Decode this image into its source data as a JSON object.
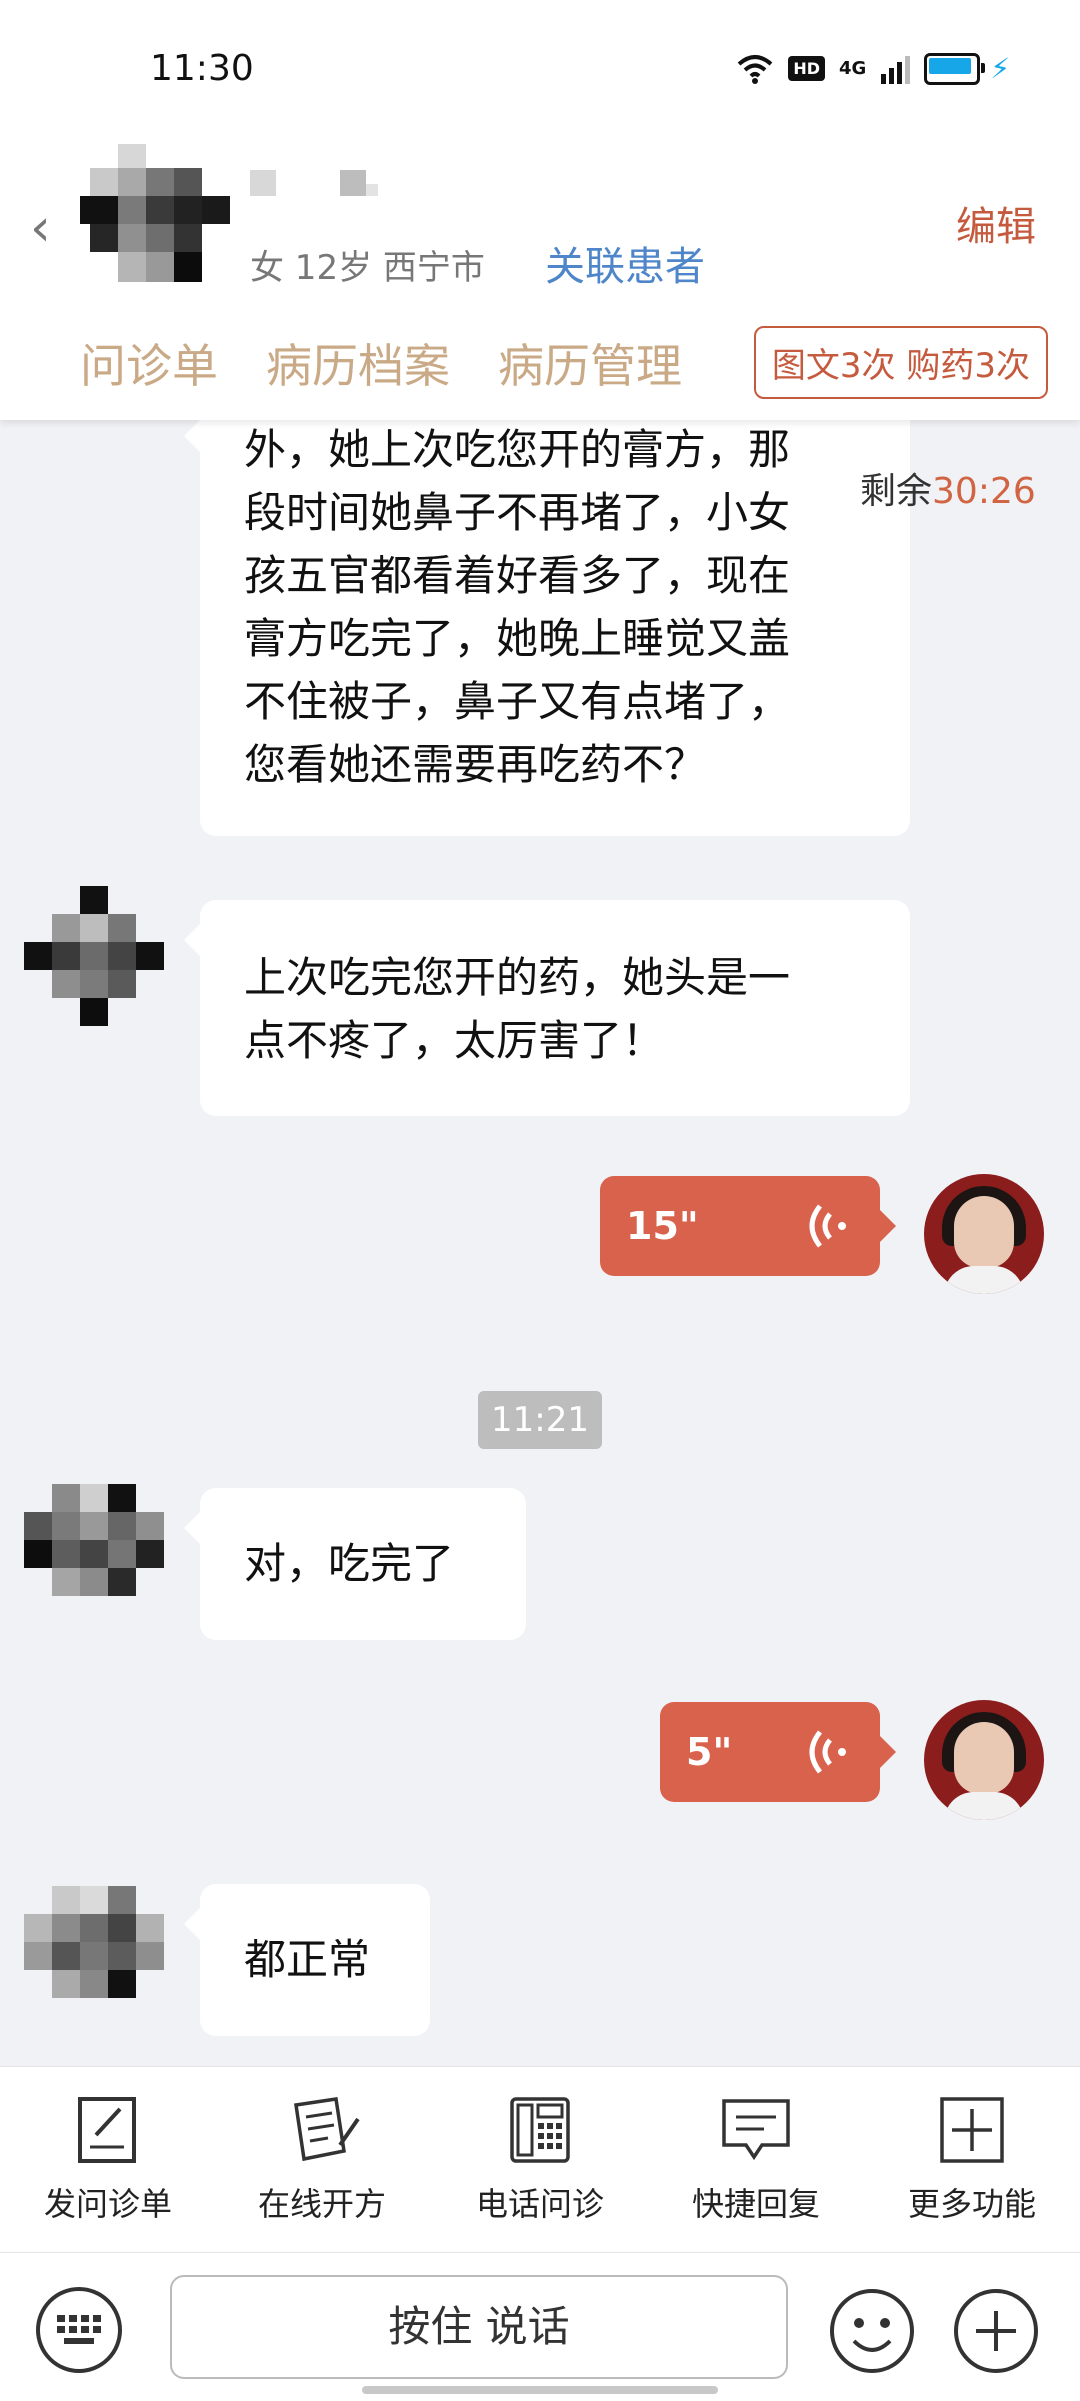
{
  "status_bar": {
    "time": "11:30",
    "hd": "HD",
    "network": "4G"
  },
  "header": {
    "patient_info": "女 12岁  西宁市",
    "link_label": "关联患者",
    "edit_label": "编辑",
    "tabs": [
      "问诊单",
      "病历档案",
      "病历管理"
    ],
    "quota": "图文3次 购药3次",
    "remaining_label": "剩余",
    "remaining_value": "30:26"
  },
  "messages": [
    {
      "side": "left",
      "lines": [
        "外，她上次吃您开的膏方，那",
        "段时间她鼻子不再堵了，小女",
        "孩五官都看着好看多了，现在",
        "膏方吃完了，她晚上睡觉又盖",
        "不住被子，鼻子又有点堵了，",
        "您看她还需要再吃药不？"
      ]
    },
    {
      "side": "left",
      "lines": [
        "上次吃完您开的药，她头是一",
        "点不疼了，太厉害了！"
      ]
    },
    {
      "side": "right",
      "voice": "15\""
    },
    {
      "timestamp": "11:21"
    },
    {
      "side": "left",
      "lines": [
        "对，吃完了"
      ]
    },
    {
      "side": "right",
      "voice": "5\""
    },
    {
      "side": "left",
      "lines": [
        "都正常"
      ]
    }
  ],
  "toolbar": {
    "items": [
      {
        "label": "发问诊单",
        "icon": "edit-form-icon"
      },
      {
        "label": "在线开方",
        "icon": "prescription-icon"
      },
      {
        "label": "电话问诊",
        "icon": "phone-icon"
      },
      {
        "label": "快捷回复",
        "icon": "message-icon"
      },
      {
        "label": "更多功能",
        "icon": "plus-square-icon"
      }
    ]
  },
  "input_bar": {
    "hold_to_talk": "按住 说话"
  },
  "colors": {
    "accent": "#d9624c",
    "link": "#4f86c9",
    "tab_text": "#c9a986"
  }
}
